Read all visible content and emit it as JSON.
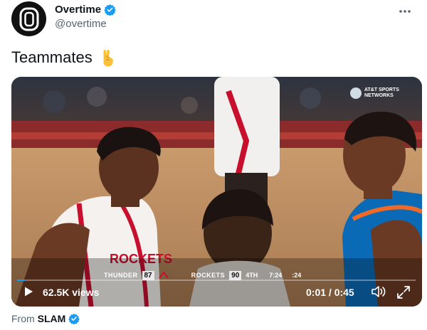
{
  "author": {
    "display_name": "Overtime",
    "handle": "@overtime",
    "verified_icon": "verified-badge-icon",
    "avatar_icon": "overtime-logo-icon"
  },
  "menu": {
    "more_icon": "more-horizontal-icon"
  },
  "tweet": {
    "text": "Teammates",
    "emoji_icon": "crossed-fingers-emoji"
  },
  "video": {
    "views": "62.5K views",
    "time": "0:01 / 0:45",
    "progress": 0.02,
    "network_logo_text": "AT&T SPORTS NETWORKS",
    "scoreboard": {
      "away_team": "THUNDER",
      "away_score": "87",
      "home_team": "ROCKETS",
      "home_score": "90",
      "quarter": "4TH",
      "clock": "7:24",
      "shot_clock": ":24"
    },
    "controls": {
      "play_icon": "play-icon",
      "volume_icon": "volume-icon",
      "fullscreen_icon": "fullscreen-icon"
    }
  },
  "attribution": {
    "prefix": "From",
    "source": "SLAM",
    "verified_icon": "verified-badge-icon"
  },
  "colors": {
    "verified_blue": "#1d9bf0",
    "text_primary": "#0f1419",
    "text_secondary": "#536471",
    "rockets_red": "#c8102e",
    "thunder_blue": "#007ac1"
  }
}
